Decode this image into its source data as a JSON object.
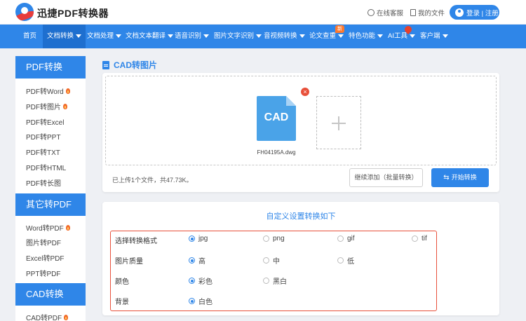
{
  "header": {
    "brand": "迅捷PDF转换器",
    "online_service": "在线客服",
    "my_files": "我的文件",
    "login": "登录 | 注册"
  },
  "nav": {
    "items": [
      {
        "label": "首页",
        "caret": false
      },
      {
        "label": "文档转换",
        "caret": true
      },
      {
        "label": "文档处理",
        "caret": true
      },
      {
        "label": "文档文本翻译",
        "caret": true
      },
      {
        "label": "语音识别",
        "caret": true
      },
      {
        "label": "图片文字识别",
        "caret": true
      },
      {
        "label": "音视频转换",
        "caret": true
      },
      {
        "label": "论文查重",
        "caret": true
      },
      {
        "label": "特色功能",
        "caret": true
      },
      {
        "label": "AI工具",
        "caret": true
      },
      {
        "label": "客户端",
        "caret": true
      }
    ],
    "new_badge": "新"
  },
  "sidebar": {
    "sections": [
      {
        "title": "PDF转换",
        "items": [
          {
            "label": "PDF转Word",
            "hot": true
          },
          {
            "label": "PDF转图片",
            "hot": true
          },
          {
            "label": "PDF转Excel",
            "hot": false
          },
          {
            "label": "PDF转PPT",
            "hot": false
          },
          {
            "label": "PDF转TXT",
            "hot": false
          },
          {
            "label": "PDF转HTML",
            "hot": false
          },
          {
            "label": "PDF转长图",
            "hot": false
          }
        ]
      },
      {
        "title": "其它转PDF",
        "items": [
          {
            "label": "Word转PDF",
            "hot": true
          },
          {
            "label": "图片转PDF",
            "hot": false
          },
          {
            "label": "Excel转PDF",
            "hot": false
          },
          {
            "label": "PPT转PDF",
            "hot": false
          }
        ]
      },
      {
        "title": "CAD转换",
        "items": [
          {
            "label": "CAD转PDF",
            "hot": true
          }
        ]
      }
    ]
  },
  "main": {
    "title": "CAD转图片",
    "file": {
      "ext": "CAD",
      "name": "FH04195A.dwg",
      "remove": "×"
    },
    "status": "已上传1个文件，共47.73K。",
    "add_more": "继续添加（批量转换）",
    "convert": "开始转换",
    "convert_icon": "⇆"
  },
  "settings": {
    "title": "自定义设置转换如下",
    "rows": [
      {
        "label": "选择转换格式",
        "options": [
          {
            "label": "jpg",
            "checked": true
          },
          {
            "label": "png",
            "checked": false
          },
          {
            "label": "gif",
            "checked": false
          },
          {
            "label": "tif",
            "checked": false
          }
        ]
      },
      {
        "label": "图片质量",
        "options": [
          {
            "label": "高",
            "checked": true
          },
          {
            "label": "中",
            "checked": false
          },
          {
            "label": "低",
            "checked": false
          }
        ]
      },
      {
        "label": "颜色",
        "options": [
          {
            "label": "彩色",
            "checked": true
          },
          {
            "label": "黑白",
            "checked": false
          }
        ]
      },
      {
        "label": "背景",
        "options": [
          {
            "label": "白色",
            "checked": true
          }
        ]
      }
    ]
  },
  "colors": {
    "accent": "#2f86e8",
    "highlight_border": "#e8503a",
    "hot": "#f26a2a"
  }
}
